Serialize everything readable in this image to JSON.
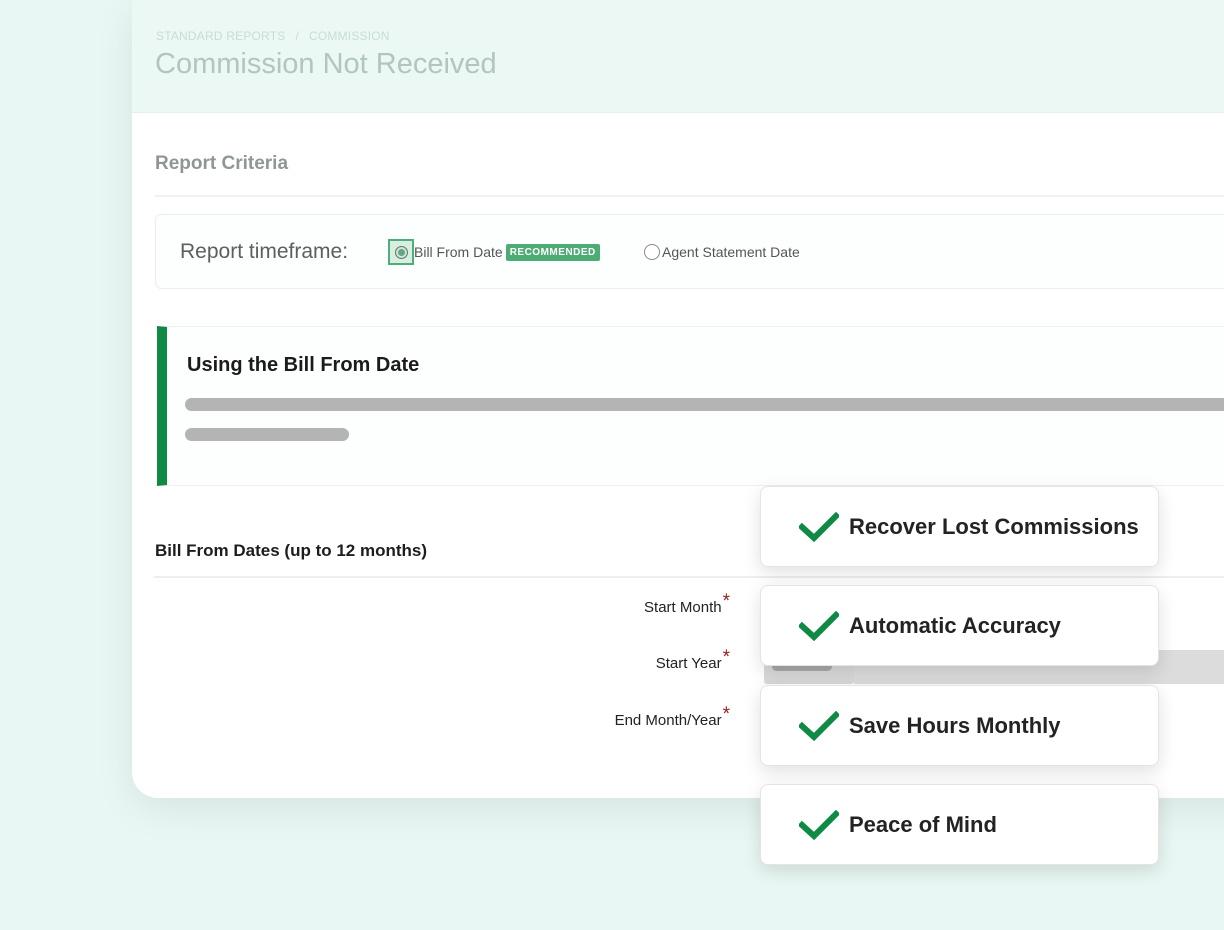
{
  "header": {
    "breadcrumb": [
      "STANDARD REPORTS",
      "/",
      "COMMISSION"
    ],
    "title": "Commission Not Received"
  },
  "criteria": {
    "section_title": "Report Criteria",
    "timeframe_label": "Report timeframe:",
    "options": [
      {
        "label": "Bill From Date",
        "badge": "RECOMMENDED",
        "selected": true
      },
      {
        "label": "Agent Statement Date",
        "selected": false
      }
    ]
  },
  "info_panel": {
    "title": "Using the Bill From Date"
  },
  "dates": {
    "section_title": "Bill From Dates (up to 12 months)",
    "fields": [
      {
        "label": "Start Month",
        "required_mark": "*"
      },
      {
        "label": "Start Year",
        "required_mark": "*"
      },
      {
        "label": "End Month/Year",
        "required_mark": "*"
      }
    ]
  },
  "benefits": [
    {
      "label": "Recover Lost Commissions",
      "icon": "checkmark-icon"
    },
    {
      "label": "Automatic Accuracy",
      "icon": "checkmark-icon"
    },
    {
      "label": "Save Hours Monthly",
      "icon": "checkmark-icon"
    },
    {
      "label": "Peace of Mind",
      "icon": "checkmark-icon"
    }
  ],
  "colors": {
    "background": "#e8f7f3",
    "brand_green": "#0f8a45",
    "badge_green": "#4dac74",
    "required_red": "#9c1c1c"
  }
}
